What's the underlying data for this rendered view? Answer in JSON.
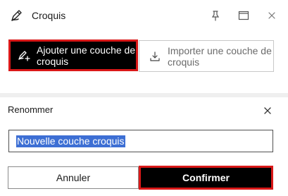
{
  "header": {
    "icon": "sketch-pen-icon",
    "title": "Croquis",
    "actions": [
      {
        "name": "pin-icon"
      },
      {
        "name": "maximize-icon"
      },
      {
        "name": "close-icon"
      }
    ]
  },
  "actions": {
    "add_sketch_layer": "Ajouter une couche de croquis",
    "import_sketch_layer": "Importer une couche de croquis"
  },
  "rename": {
    "title": "Renommer",
    "close_icon": "close-icon",
    "input_value": "Nouvelle couche croquis",
    "cancel_label": "Annuler",
    "confirm_label": "Confirmer"
  },
  "colors": {
    "highlight_border": "#d91818",
    "selection": "#3d6fd4",
    "primary_button": "#000000"
  }
}
